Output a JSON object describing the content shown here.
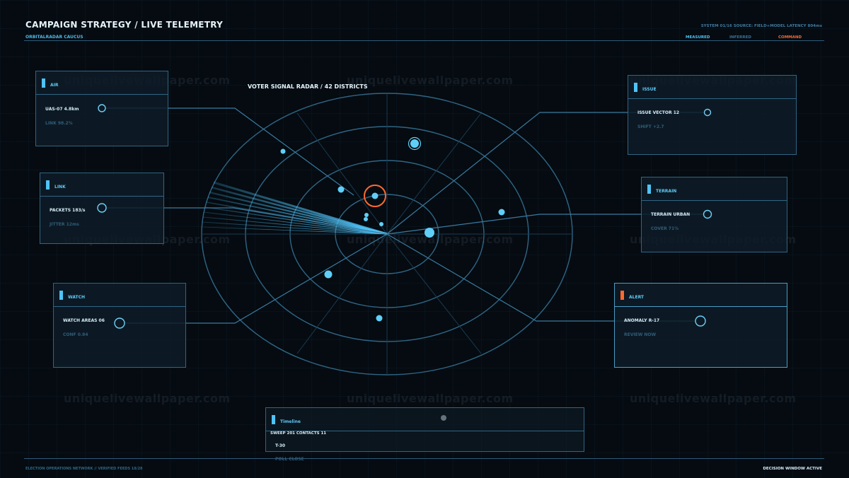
{
  "header": {
    "title": "CAMPAIGN STRATEGY / LIVE TELEMETRY",
    "subtitle": "ORBITALRADAR CAUCUS",
    "system_info": "SYSTEM 01/16  SOURCE: FIELD+MODEL  LATENCY 804ms",
    "legend": [
      {
        "label": "MEASURED",
        "color": "#4fc3f7"
      },
      {
        "label": "INFERRED",
        "color": "#3a6f94"
      },
      {
        "label": "COMMAND",
        "color": "#ff6a2e"
      }
    ]
  },
  "radar": {
    "title": "VOTER SIGNAL RADAR / 42 DISTRICTS"
  },
  "panels": {
    "air": {
      "title": "AIR",
      "value": "UAS-07  4.8km",
      "sub": "LINK 98.2%"
    },
    "link": {
      "title": "LINK",
      "value": "PACKETS 183/s",
      "sub": "JITTER 12ms"
    },
    "watch": {
      "title": "WATCH",
      "value": "WATCH AREAS 06",
      "sub": "CONF 0.84"
    },
    "issue": {
      "title": "ISSUE",
      "value": "ISSUE VECTOR 12",
      "sub": "SHIFT +2.7"
    },
    "terrain": {
      "title": "TERRAIN",
      "value": "TERRAIN URBAN",
      "sub": "COVER 71%"
    },
    "alert": {
      "title": "ALERT",
      "value": "ANOMALY R-17",
      "sub": "REVIEW NOW"
    },
    "timeline": {
      "title": "Timeline",
      "value": "SWEEP 201  CONTACTS 11",
      "marker": "T-30",
      "sub": "POLL CLOSE"
    }
  },
  "watermark": "uniquelivewallpaper.com",
  "footer": {
    "left": "ELECTION OPERATIONS NETWORK // VERIFIED FEEDS 18/28",
    "right": "DECISION WINDOW ACTIVE"
  },
  "colors": {
    "accent": "#4fc3f7",
    "grid": "#2f6584",
    "alert": "#ff6a2e",
    "background": "#050b11"
  }
}
